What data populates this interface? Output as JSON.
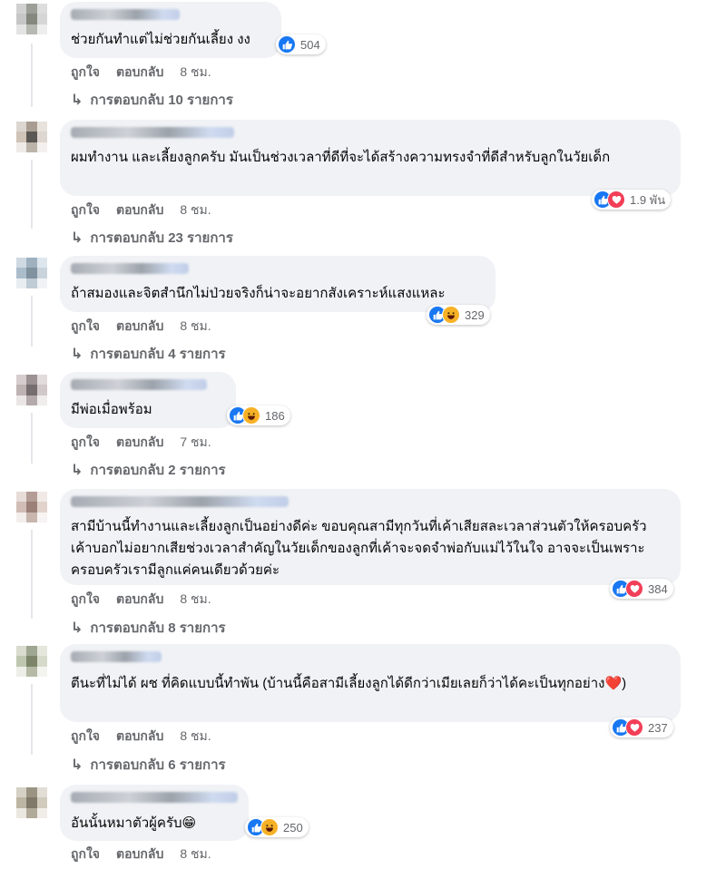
{
  "colors": {
    "like": "#1877f2",
    "love": "#f33e58",
    "haha": "#f7b125",
    "bubble": "#f0f2f5",
    "meta": "#65676b"
  },
  "icons": {
    "like": "thumbs-up-icon",
    "love": "heart-icon",
    "haha": "laugh-icon",
    "reply_arrow": "reply-arrow-icon"
  },
  "labels": {
    "like": "ถูกใจ",
    "reply": "ตอบกลับ"
  },
  "comments": [
    {
      "text": "ช่วยกันทำแต่ไม่ช่วยกันเลี้ยง งง",
      "reactions": [
        "like"
      ],
      "count": "504",
      "time": "8 ชม.",
      "replies": "การตอบกลับ 10 รายการ"
    },
    {
      "text": "ผมทำงาน และเลี้ยงลูกครับ มันเป็นช่วงเวลาที่ดีที่จะได้สร้างความทรงจำที่ดีสำหรับลูกในวัยเด็ก",
      "reactions": [
        "like",
        "love"
      ],
      "count": "1.9 พัน",
      "time": "8 ชม.",
      "replies": "การตอบกลับ 23 รายการ"
    },
    {
      "text": "ถ้าสมองและจิตสำนึกไม่ป่วยจริงก็น่าจะอยากสังเคราะห์แสงแหละ",
      "reactions": [
        "like",
        "haha"
      ],
      "count": "329",
      "time": "8 ชม.",
      "replies": "การตอบกลับ 4 รายการ"
    },
    {
      "text": "มีพ่อเมื่อพร้อม",
      "reactions": [
        "like",
        "haha"
      ],
      "count": "186",
      "time": "7 ชม.",
      "replies": "การตอบกลับ 2 รายการ"
    },
    {
      "text": "สามีบ้านนี้ทำงานและเลี้ยงลูกเป็นอย่างดีค่ะ ขอบคุณสามีทุกวันที่เค้าเสียสละเวลาส่วนตัวให้ครอบครัว เค้าบอกไม่อยากเสียช่วงเวลาสำคัญในวัยเด็กของลูกที่เค้าจะจดจำพ่อกับแม่ไว้ในใจ อาจจะเป็นเพราะครอบครัวเรามีลูกแค่คนเดียวด้วยค่ะ",
      "reactions": [
        "like",
        "love"
      ],
      "count": "384",
      "time": "8 ชม.",
      "replies": "การตอบกลับ 8 รายการ"
    },
    {
      "text": "ตีนะที่ไม่ได้ ผช ที่คิดแบบนี้ทำพัน (บ้านนี้คือสามีเลี้ยงลูกได้ดีกว่าเมียเลยก็ว่าได้คะเป็นทุกอย่าง❤️)",
      "reactions": [
        "like",
        "love"
      ],
      "count": "237",
      "time": "8 ชม.",
      "replies": "การตอบกลับ 6 รายการ"
    },
    {
      "text": "อันนั้นหมาตัวผู้ครับ😁",
      "reactions": [
        "like",
        "haha"
      ],
      "count": "250",
      "time": "8 ชม.",
      "replies": ""
    }
  ]
}
